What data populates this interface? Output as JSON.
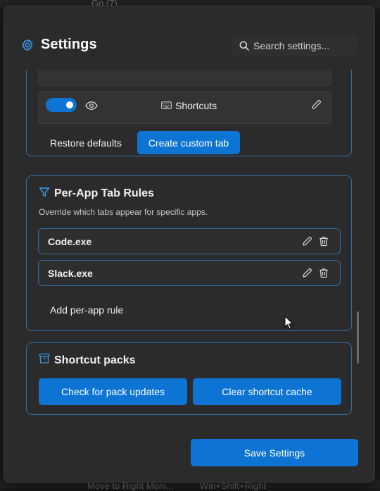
{
  "dialog": {
    "title": "Settings",
    "search_placeholder": "Search settings..."
  },
  "tabs_section": {
    "shortcuts_tab_label": "Shortcuts",
    "shortcuts_tab_enabled": true,
    "restore_defaults_label": "Restore defaults",
    "create_custom_tab_label": "Create custom tab"
  },
  "per_app_rules": {
    "title": "Per-App Tab Rules",
    "description": "Override which tabs appear for specific apps.",
    "rules": [
      {
        "name": "Code.exe"
      },
      {
        "name": "Slack.exe"
      }
    ],
    "add_rule_label": "Add per-app rule"
  },
  "shortcut_packs": {
    "title": "Shortcut packs",
    "check_updates_label": "Check for pack updates",
    "clear_cache_label": "Clear shortcut cache"
  },
  "footer": {
    "save_label": "Save Settings"
  },
  "background": {
    "top_hint": "Go (7)",
    "bottom_hint": "Move to Right Moni...",
    "bottom_hint_keys": "Win+Shift+Right"
  },
  "icons": {
    "title": "gear-icon",
    "search": "search-icon",
    "visibility": "eye-icon",
    "tab_type": "keyboard-icon",
    "edit": "pencil-icon",
    "delete": "trash-icon",
    "filter": "filter-icon",
    "packs": "archive-icon"
  },
  "colors": {
    "accent": "#0e74d4",
    "card_border": "#2f6ea8",
    "dialog_bg": "#2b2b2b"
  }
}
